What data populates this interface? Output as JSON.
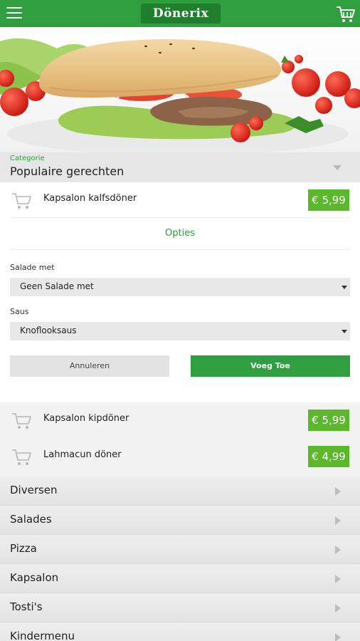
{
  "header": {
    "logo_text": "Dönerix",
    "menu_icon": "hamburger-menu-icon",
    "cart_icon": "shopping-cart-icon",
    "brand_color": "#2f9e3f"
  },
  "category": {
    "label": "Categorie",
    "value": "Populaire gerechten"
  },
  "expanded_product": {
    "name": "Kapsalon kalfsdöner",
    "price": "€ 5,99",
    "options_label": "Opties",
    "fields": [
      {
        "label": "Salade met",
        "value": "Geen Salade met"
      },
      {
        "label": "Saus",
        "value": "Knoflooksaus"
      }
    ],
    "cancel_label": "Annuleren",
    "add_label": "Voeg Toe"
  },
  "products": [
    {
      "name": "Kapsalon kipdöner",
      "price": "€ 5,99"
    },
    {
      "name": "Lahmacun döner",
      "price": "€ 4,99"
    }
  ],
  "nav_items": [
    "Diversen",
    "Salades",
    "Pizza",
    "Kapsalon",
    "Tosti's",
    "Kindermenu"
  ],
  "colors": {
    "accent": "#2f9e3f",
    "price_badge": "#5cb82b"
  }
}
